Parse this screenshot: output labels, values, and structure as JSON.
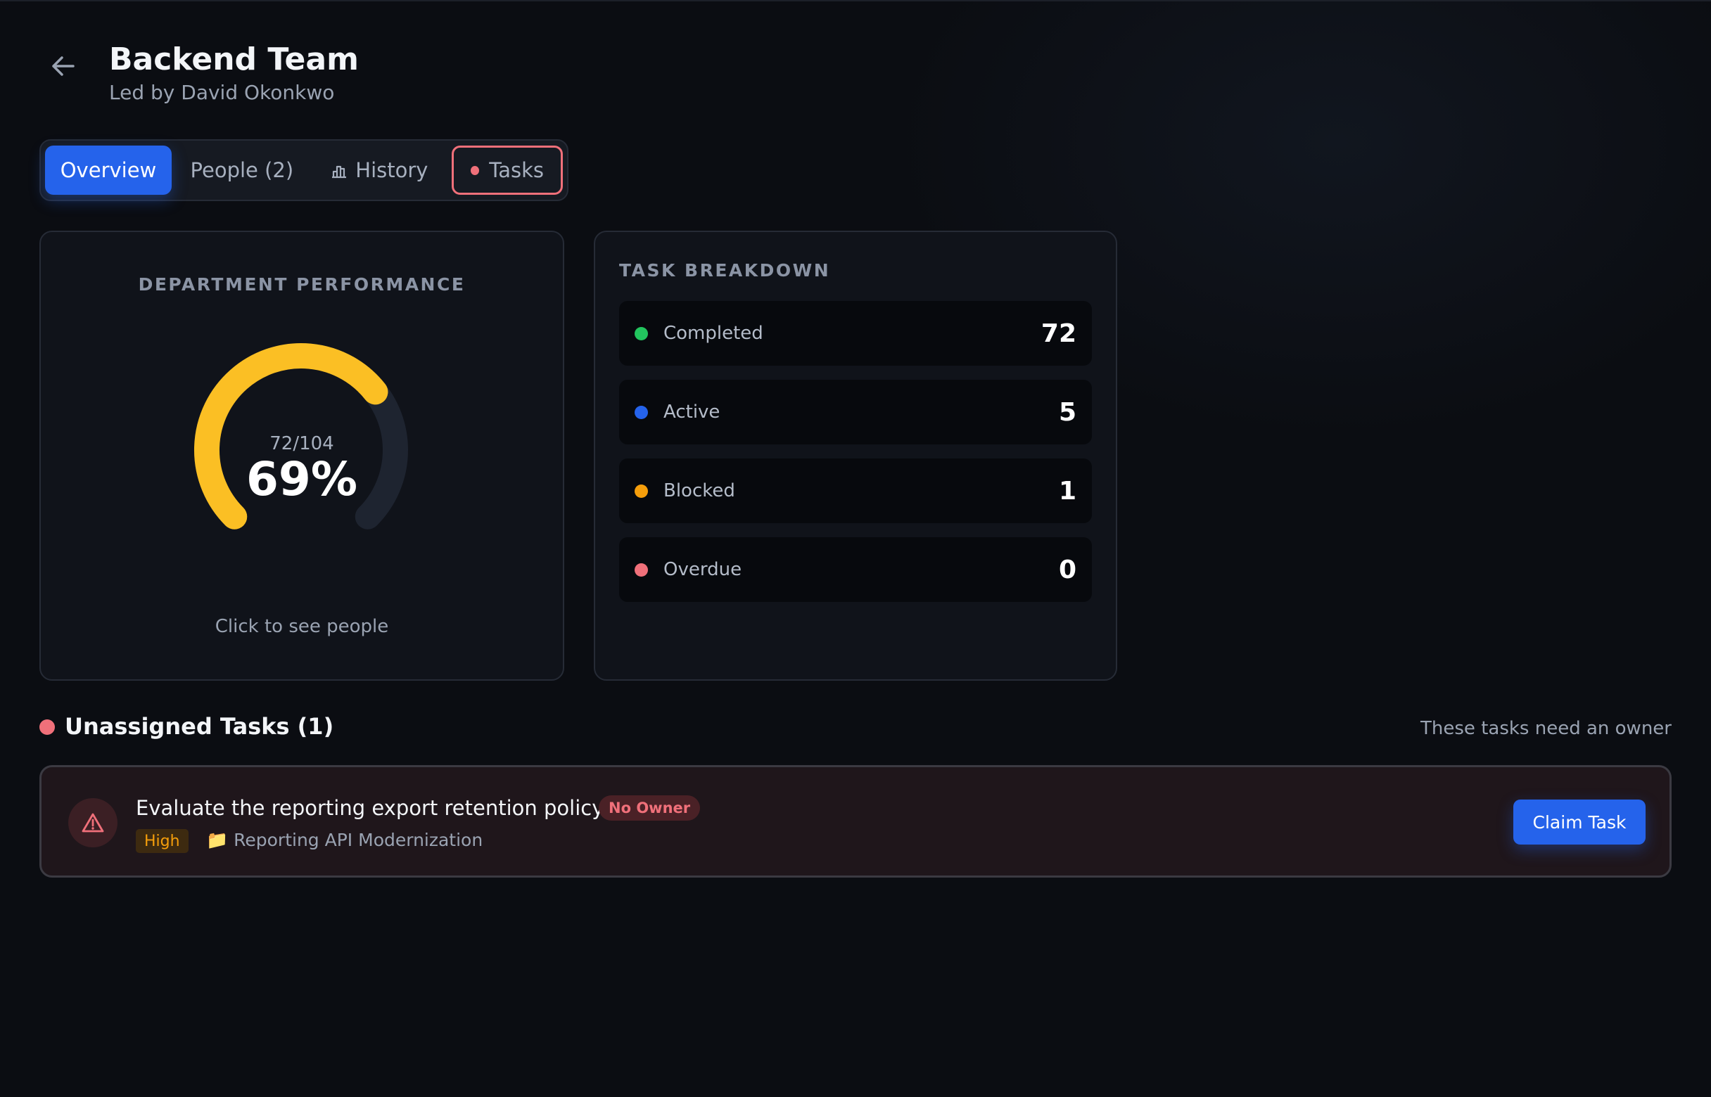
{
  "header": {
    "back_icon": "arrow-left-icon",
    "title": "Backend Team",
    "subtitle": "Led by David Okonkwo"
  },
  "tabs": [
    {
      "label": "Overview",
      "active": true
    },
    {
      "label": "People (2)",
      "active": false
    },
    {
      "label": "History",
      "icon": "bar-chart-icon",
      "active": false
    },
    {
      "label": "Tasks",
      "icon": "red-dot",
      "active": false
    }
  ],
  "performance": {
    "heading": "DEPARTMENT PERFORMANCE",
    "fraction": "72/104",
    "percent_label": "69%",
    "completed": 72,
    "total": 104,
    "hint": "Click to see people",
    "gauge_color": "#fbbf24",
    "track_color": "#1e2430"
  },
  "breakdown": {
    "heading": "TASK BREAKDOWN",
    "rows": [
      {
        "label": "Completed",
        "value": "72",
        "color": "#22c55e"
      },
      {
        "label": "Active",
        "value": "5",
        "color": "#2563eb"
      },
      {
        "label": "Blocked",
        "value": "1",
        "color": "#f59e0b"
      },
      {
        "label": "Overdue",
        "value": "0",
        "color": "#f0707a"
      }
    ]
  },
  "unassigned": {
    "title": "Unassigned Tasks (1)",
    "note": "These tasks need an owner",
    "tasks": [
      {
        "title": "Evaluate the reporting export retention policy",
        "badge": "No Owner",
        "priority": "High",
        "project": "Reporting API Modernization",
        "action": "Claim Task"
      }
    ]
  }
}
